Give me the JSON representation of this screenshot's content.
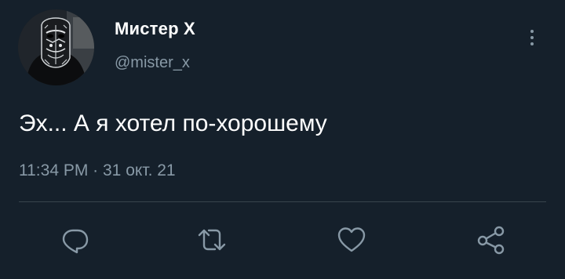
{
  "tweet": {
    "author_name": "Мистер Х",
    "author_handle": "@mister_x",
    "text": "Эх... А я хотел по-хорошему",
    "time": "11:34 PM",
    "separator": " · ",
    "date": "31 окт. 21"
  },
  "actions": {
    "icons": [
      "reply-icon",
      "retweet-icon",
      "like-icon",
      "share-icon"
    ]
  },
  "colors": {
    "background": "#15202b",
    "primary_text": "#ffffff",
    "secondary_text": "#8899a6",
    "divider": "#38444d"
  }
}
